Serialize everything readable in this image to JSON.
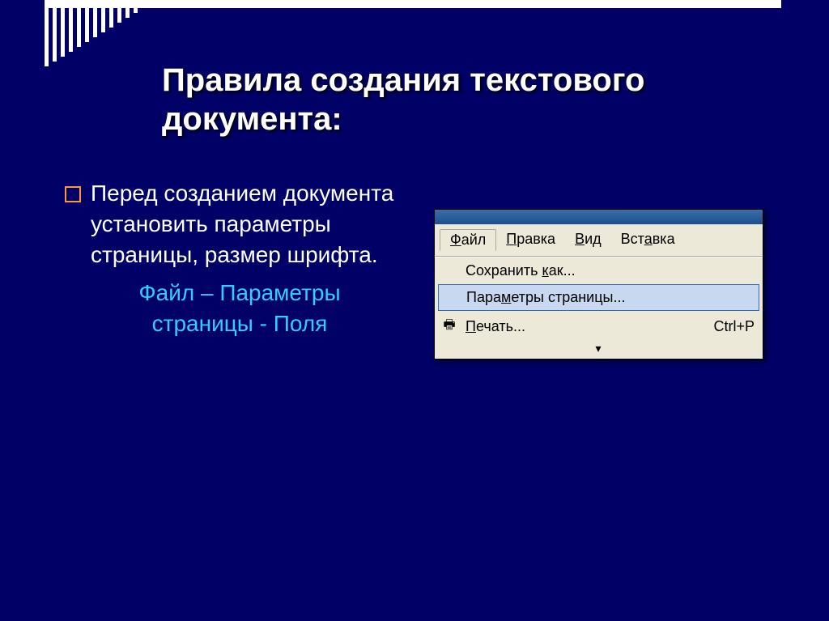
{
  "title": "Правила создания текстового документа:",
  "bullet1": "Перед созданием документа установить параметры страницы, размер шрифта.",
  "sub_path": "Файл – Параметры страницы - Поля",
  "menu": {
    "file": "Файл",
    "edit": "Правка",
    "view": "Вид",
    "insert": "Вставка",
    "save_as": "Сохранить как...",
    "page_setup": "Параметры страницы...",
    "print": "Печать...",
    "print_shortcut": "Ctrl+P",
    "expand": "˅"
  }
}
